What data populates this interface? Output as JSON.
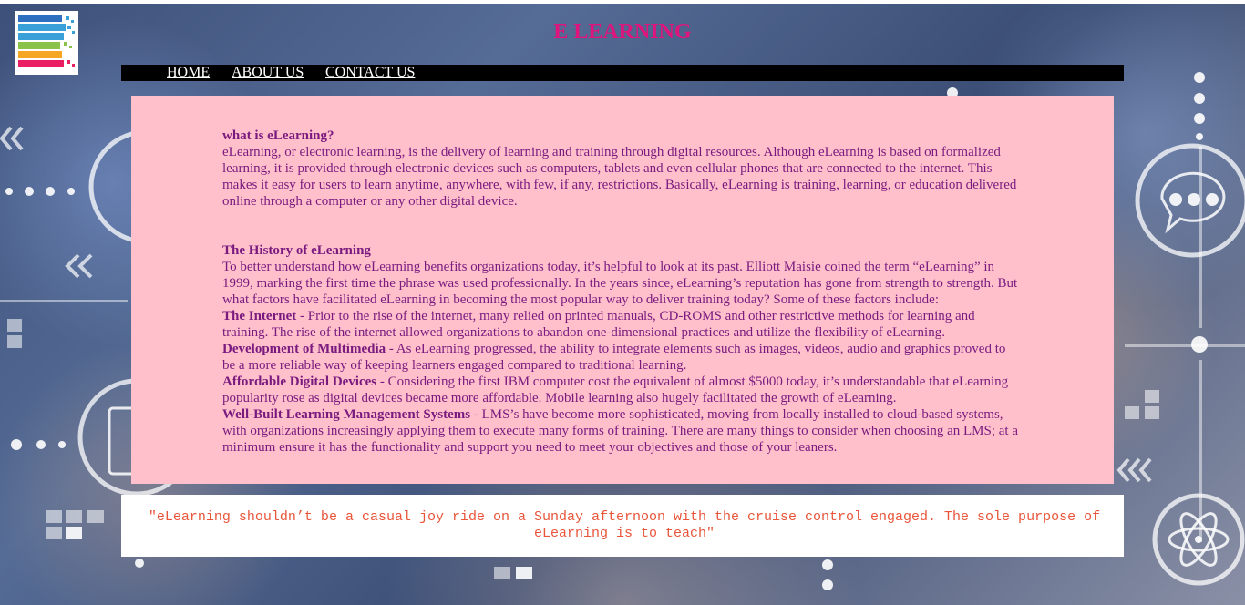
{
  "header": {
    "title": "E LEARNING",
    "logo_icon": "stacked-books-logo-icon"
  },
  "nav": {
    "items": [
      {
        "label": "HOME"
      },
      {
        "label": "ABOUT US"
      },
      {
        "label": "CONTACT US"
      }
    ]
  },
  "content": {
    "section1": {
      "heading": "what is eLearning?",
      "body": "eLearning, or electronic learning, is the delivery of learning and training through digital resources. Although eLearning is based on formalized learning, it is provided through electronic devices such as computers, tablets and even cellular phones that are connected to the internet. This makes it easy for users to learn anytime, anywhere, with few, if any, restrictions. Basically, eLearning is training, learning, or education delivered online through a computer or any other digital device."
    },
    "section2": {
      "heading": "The History of eLearning",
      "intro": "To better understand how eLearning benefits organizations today, it’s helpful to look at its past. Elliott Maisie coined the term “eLearning” in 1999, marking the first time the phrase was used professionally. In the years since, eLearning’s reputation has gone from strength to strength. But what factors have facilitated eLearning in becoming the most popular way to deliver training today? Some of these factors include:",
      "factors": [
        {
          "title": "The Internet",
          "text": " - Prior to the rise of the internet, many relied on printed manuals, CD-ROMS and other restrictive methods for learning and training. The rise of the internet allowed organizations to abandon one-dimensional practices and utilize the flexibility of eLearning."
        },
        {
          "title": "Development of Multimedia",
          "text": " - As eLearning progressed, the ability to integrate elements such as images, videos, audio and graphics proved to be a more reliable way of keeping learners engaged compared to traditional learning."
        },
        {
          "title": "Affordable Digital Devices",
          "text": " - Considering the first IBM computer cost the equivalent of almost $5000 today, it’s understandable that eLearning popularity rose as digital devices became more affordable. Mobile learning also hugely facilitated the growth of eLearning."
        },
        {
          "title": "Well-Built Learning Management Systems",
          "text": " - LMS’s have become more sophisticated, moving from locally installed to cloud-based systems, with organizations increasingly applying them to execute many forms of training. There are many things to consider when choosing an LMS; at a minimum ensure it has the functionality and support you need to meet your objectives and those of your leaners."
        }
      ]
    }
  },
  "quote": {
    "text": "\"eLearning shouldn’t be a casual joy ride on a Sunday afternoon with the cruise control engaged. The sole purpose of eLearning is to teach\""
  },
  "colors": {
    "title": "#e0147d",
    "nav_bg": "#000000",
    "content_bg": "#ffc0cb",
    "content_text": "#7a1a7f",
    "quote_text": "#e8553a"
  }
}
